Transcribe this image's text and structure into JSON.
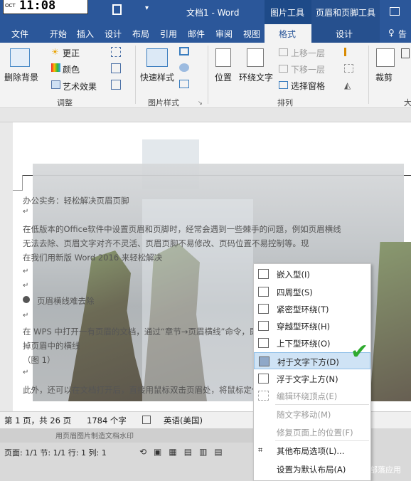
{
  "window": {
    "title": "文档1 - Word",
    "clock": "11:08",
    "clock_badge": "OCT",
    "context_tabs": [
      "图片工具",
      "页眉和页脚工具"
    ]
  },
  "tabs": [
    "文件",
    "开始",
    "插入",
    "设计",
    "布局",
    "引用",
    "邮件",
    "审阅",
    "视图",
    "格式",
    "设计"
  ],
  "tell_me": "告",
  "ribbon": {
    "remove_bg": "删除背景",
    "correct": "更正",
    "color": "颜色",
    "artistic": "艺术效果",
    "group_adjust": "调整",
    "quick_styles": "快速样式",
    "group_picture_styles": "图片样式",
    "position": "位置",
    "wrap_text": "环绕文字",
    "bring_forward": "上移一层",
    "send_backward": "下移一层",
    "selection_pane": "选择窗格",
    "group_arrange": "排列",
    "crop": "裁剪",
    "size_partial": "大"
  },
  "document": {
    "lines": [
      "办公实务：轻松解决页眉页脚",
      "在低版本的Office软件中设置页眉和页脚时，经常会遇到一些棘手的问题，例如页眉横线",
      "无法去除、页眉文字对齐不灵活、页眉页脚不易修改、页码位置不易控制等。现",
      "在我们用新版 Word 2016 来轻松解决",
      "页眉横线难去除",
      "在 WPS 中打开一有页眉的文档，通过“章节→页眉横线”命令，即可去",
      "掉页眉中的横线",
      "（图 1）",
      "此外，还可以在文档打开后，直接用鼠标双击页眉处，将鼠标定位至菜单将自动开"
    ]
  },
  "wrap_menu": {
    "items": [
      {
        "label": "嵌入型(I)",
        "enabled": true
      },
      {
        "label": "四周型(S)",
        "enabled": true
      },
      {
        "label": "紧密型环绕(T)",
        "enabled": true
      },
      {
        "label": "穿越型环绕(H)",
        "enabled": true
      },
      {
        "label": "上下型环绕(O)",
        "enabled": true
      },
      {
        "label": "衬于文字下方(D)",
        "enabled": true
      },
      {
        "label": "浮于文字上方(N)",
        "enabled": true
      },
      {
        "label": "编辑环绕顶点(E)",
        "enabled": false
      },
      {
        "label": "随文字移动(M)",
        "enabled": false
      },
      {
        "label": "修复页面上的位置(F)",
        "enabled": false
      },
      {
        "label": "其他布局选项(L)...",
        "enabled": true
      },
      {
        "label": "设置为默认布局(A)",
        "enabled": true
      }
    ],
    "highlighted_index": 5
  },
  "statusbar": {
    "page": "第 1 页，共 26 页",
    "words": "1784 个字",
    "language": "英语(美国)"
  },
  "bottom": {
    "caption": "用页眉图片制造文档水印",
    "status2": "页面: 1/1  节: 1/1  行: 1  列: 1",
    "watermark": "IT部落应用"
  },
  "colors": {
    "word_blue": "#2b579a",
    "check_green": "#2eaa2e",
    "highlight": "#cfe3f5"
  }
}
